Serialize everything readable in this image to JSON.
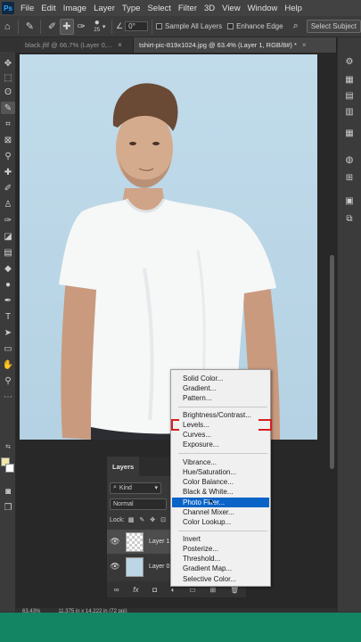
{
  "app": {
    "logo": "Ps"
  },
  "menubar": {
    "items": [
      "File",
      "Edit",
      "Image",
      "Layer",
      "Type",
      "Select",
      "Filter",
      "3D",
      "View",
      "Window",
      "Help"
    ]
  },
  "options_bar": {
    "brush_size": "25",
    "angle_value": "0°",
    "sample_all_layers_label": "Sample All Layers",
    "enhance_edge_label": "Enhance Edge",
    "select_subject_label": "Select Subject"
  },
  "tabs": [
    {
      "label": "black.jfif @ 66.7% (Layer 0,...",
      "close": "×",
      "active": false
    },
    {
      "label": "tshirt-pic-819x1024.jpg @ 63.4% (Layer 1, RGB/8#) *",
      "close": "×",
      "active": true
    }
  ],
  "layers_panel": {
    "tab_label": "Layers",
    "filter_label": "Kind",
    "blend_mode": "Normal",
    "lock_label": "Lock:",
    "layers": [
      {
        "name": "Layer 1",
        "selected": true
      },
      {
        "name": "Layer 0 c",
        "selected": false
      }
    ],
    "footer_icons": [
      "link-icon",
      "fx-icon",
      "mask-icon",
      "adjustment-icon",
      "folder-icon",
      "new-layer-icon",
      "trash-icon"
    ]
  },
  "adjustment_menu": {
    "groups": [
      [
        "Solid Color...",
        "Gradient...",
        "Pattern..."
      ],
      [
        "Brightness/Contrast...",
        "Levels...",
        "Curves...",
        "Exposure..."
      ],
      [
        "Vibrance...",
        "Hue/Saturation...",
        "Color Balance...",
        "Black & White...",
        "Photo Filter...",
        "Channel Mixer...",
        "Color Lookup..."
      ],
      [
        "Invert",
        "Posterize...",
        "Threshold...",
        "Gradient Map...",
        "Selective Color..."
      ]
    ],
    "highlighted": "Photo Filter..."
  },
  "status_bar": {
    "zoom": "63.43%",
    "doc_size": "11.375 in x 14.222 in (72 ppi)"
  },
  "colors": {
    "foreground": "#f1e7a8",
    "background": "#ffffff",
    "highlight": "#0a64c8",
    "annotation": "#d42020",
    "bottom_band": "#148562",
    "canvas_backdrop": "#b9d6e6"
  }
}
